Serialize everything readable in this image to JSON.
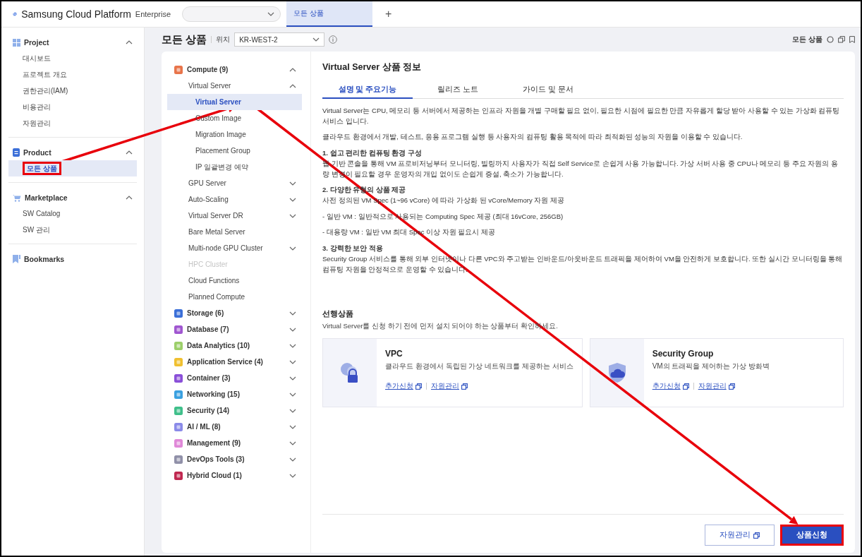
{
  "topbar": {
    "brand": "Samsung Cloud Platform",
    "edition": "Enterprise",
    "tabs": [
      {
        "label": "모든 상품",
        "selected": true
      }
    ],
    "add_tab": "+"
  },
  "sidebar": {
    "sections": [
      {
        "kind": "project",
        "title": "Project",
        "expanded": true,
        "items": [
          {
            "label": "대시보드",
            "selected": false,
            "highlighted": false
          },
          {
            "label": "프로젝트 개요",
            "selected": false,
            "highlighted": false
          },
          {
            "label": "권한관리(IAM)",
            "selected": false,
            "highlighted": false
          },
          {
            "label": "비용관리",
            "selected": false,
            "highlighted": false
          },
          {
            "label": "자원관리",
            "selected": false,
            "highlighted": false
          }
        ]
      },
      {
        "kind": "product",
        "title": "Product",
        "expanded": true,
        "items": [
          {
            "label": "모든 상품",
            "selected": true,
            "highlighted": true
          }
        ]
      },
      {
        "kind": "marketplace",
        "title": "Marketplace",
        "expanded": true,
        "items": [
          {
            "label": "SW Catalog",
            "selected": false,
            "highlighted": false
          },
          {
            "label": "SW 관리",
            "selected": false,
            "highlighted": false
          }
        ]
      },
      {
        "kind": "bookmarks",
        "title": "Bookmarks"
      }
    ]
  },
  "page_header": {
    "title": "모든 상품",
    "location_label": "위치",
    "location": "KR-WEST-2",
    "breadcrumb": "모든 상품"
  },
  "product_nav": [
    {
      "label": "Compute (9)",
      "color": "#e8744a",
      "expanded": true,
      "children": [
        {
          "label": "Virtual Server",
          "kind": "group",
          "expanded": true,
          "disabled": false,
          "children": [
            {
              "label": "Virtual Server",
              "selected": true,
              "highlighted": true
            },
            {
              "label": "Custom Image",
              "selected": false,
              "highlighted": false
            },
            {
              "label": "Migration Image",
              "selected": false,
              "highlighted": false
            },
            {
              "label": "Placement Group",
              "selected": false,
              "highlighted": false
            },
            {
              "label": "IP 일괄변경 예약",
              "selected": false,
              "highlighted": false
            }
          ]
        },
        {
          "label": "GPU Server",
          "kind": "group",
          "expanded": false,
          "disabled": false
        },
        {
          "label": "Auto-Scaling",
          "kind": "group",
          "expanded": false,
          "disabled": false
        },
        {
          "label": "Virtual Server DR",
          "kind": "group",
          "expanded": false,
          "disabled": false
        },
        {
          "label": "Bare Metal Server",
          "kind": "leaf",
          "disabled": false
        },
        {
          "label": "Multi-node GPU Cluster",
          "kind": "group",
          "expanded": false,
          "disabled": false
        },
        {
          "label": "HPC Cluster",
          "kind": "leaf",
          "disabled": true
        },
        {
          "label": "Cloud Functions",
          "kind": "leaf",
          "disabled": false
        },
        {
          "label": "Planned Compute",
          "kind": "leaf",
          "disabled": false
        }
      ]
    },
    {
      "label": "Storage (6)",
      "color": "#3b6fd8",
      "expanded": false
    },
    {
      "label": "Database (7)",
      "color": "#a056d0",
      "expanded": false
    },
    {
      "label": "Data Analytics (10)",
      "color": "#9ccf6a",
      "expanded": false
    },
    {
      "label": "Application Service (4)",
      "color": "#f0c030",
      "expanded": false
    },
    {
      "label": "Container (3)",
      "color": "#8a4fd8",
      "expanded": false
    },
    {
      "label": "Networking (15)",
      "color": "#3aa0e0",
      "expanded": false
    },
    {
      "label": "Security (14)",
      "color": "#3fbf8a",
      "expanded": false
    },
    {
      "label": "AI / ML (8)",
      "color": "#8a8ae8",
      "expanded": false
    },
    {
      "label": "Management (9)",
      "color": "#e088d8",
      "expanded": false
    },
    {
      "label": "DevOps Tools (3)",
      "color": "#9090a8",
      "expanded": false
    },
    {
      "label": "Hybrid Cloud (1)",
      "color": "#c02850",
      "expanded": false
    }
  ],
  "detail": {
    "title": "Virtual Server 상품 정보",
    "tabs": [
      {
        "label": "설명 및 주요기능",
        "selected": true
      },
      {
        "label": "릴리즈 노트",
        "selected": false
      },
      {
        "label": "가이드 및 문서",
        "selected": false
      }
    ],
    "blocks": [
      {
        "kind": "paragraph",
        "text": "Virtual Server는 CPU, 메모리 등 서버에서 제공하는 인프라 자원을 개별 구매할 필요 없이, 필요한 시점에 필요한 만큼 자유롭게 할당 받아 사용할 수 있는 가상화 컴퓨팅 서비스 입니다."
      },
      {
        "kind": "paragraph",
        "text": "클라우드 환경에서 개발, 테스트, 응용 프로그램 실행 등 사용자의 컴퓨팅 활용 목적에 따라 최적화된 성능의 자원을 이용할 수 있습니다."
      },
      {
        "kind": "heading",
        "text": "1. 쉽고 편리한 컴퓨팅 환경 구성"
      },
      {
        "kind": "text",
        "text": "웹 기반 콘솔을 통해 VM 프로비저닝부터 모니터링, 빌링까지 사용자가 직접 Self Service로 손쉽게 사용 가능합니다. 가상 서버 사용 중 CPU나 메모리 등 주요 자원의 용량 변경이 필요할 경우 운영자의 개입 없이도 손쉽게 증설, 축소가 가능합니다."
      },
      {
        "kind": "heading",
        "text": "2. 다양한 유형의 상품 제공"
      },
      {
        "kind": "text",
        "text": "사전 정의된 VM Spec (1~96 vCore) 에 따라 가상화 된 vCore/Memory 자원 제공"
      },
      {
        "kind": "paragraph",
        "text": "- 일반 VM : 일반적으로 사용되는 Computing Spec 제공 (최대 16vCore, 256GB)"
      },
      {
        "kind": "paragraph",
        "text": "- 대용량 VM : 일반 VM 최대 Spec 이상 자원 필요시 제공"
      },
      {
        "kind": "heading",
        "text": "3. 강력한 보안 적용"
      },
      {
        "kind": "text",
        "text": "Security Group 서비스를 통해 외부 인터넷이나 다른 VPC와 주고받는 인바운드/아웃바운드 트래픽을 제어하여 VM을 안전하게 보호합니다. 또한 실시간 모니터링을 통해 컴퓨팅 자원을 안정적으로 운영할 수 있습니다."
      }
    ],
    "prerequisites": {
      "title": "선행상품",
      "description": "Virtual Server를 신청 하기 전에 먼저 설치 되어야 하는 상품부터 확인하세요.",
      "cards": [
        {
          "kind": "vpc",
          "title": "VPC",
          "description": "클라우드 환경에서 독립된 가상 네트워크를 제공하는 서비스",
          "links": [
            "추가신청",
            "자원관리"
          ]
        },
        {
          "kind": "security",
          "title": "Security Group",
          "description": "VM의 트래픽을 제어하는 가상 방화벽",
          "links": [
            "추가신청",
            "자원관리"
          ]
        }
      ]
    }
  },
  "actions": [
    {
      "label": "자원관리",
      "kind": "secondary",
      "highlighted": false
    },
    {
      "label": "상품신청",
      "kind": "primary",
      "highlighted": true
    }
  ]
}
